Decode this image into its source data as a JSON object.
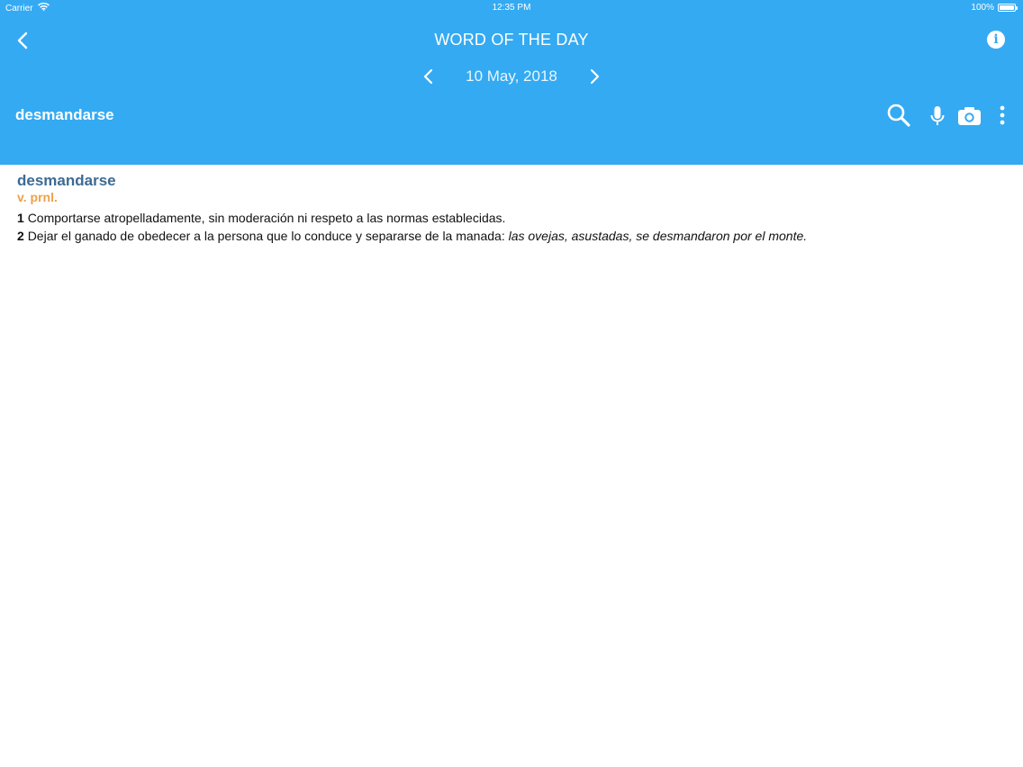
{
  "status_bar": {
    "carrier": "Carrier",
    "time": "12:35 PM",
    "battery": "100%",
    "battery_level": 1.0
  },
  "nav_bar": {
    "title": "WORD OF THE DAY",
    "back_icon": "chevron-left-icon",
    "info_icon": "info-icon"
  },
  "date_nav": {
    "date": "10 May, 2018",
    "prev_icon": "chevron-left-icon",
    "next_icon": "chevron-right-icon"
  },
  "search_bar": {
    "current_word": "desmandarse",
    "icons": [
      "search-icon",
      "microphone-icon",
      "camera-icon",
      "more-vertical-icon"
    ]
  },
  "entry": {
    "headword": "desmandarse",
    "part_of_speech": "v. prnl.",
    "senses": [
      {
        "number": "1",
        "definition": "Comportarse atropelladamente, sin moderación ni respeto a las normas establecidas.",
        "example": ""
      },
      {
        "number": "2",
        "definition": "Dejar el ganado de obedecer a la persona que lo conduce y separarse de la manada: ",
        "example": "las ovejas, asustadas, se desmandaron por el monte."
      }
    ]
  },
  "colors": {
    "header_bg": "#34aaf2",
    "headword": "#3d6a93",
    "part_of_speech": "#f0a04a",
    "body_text": "#111111"
  }
}
